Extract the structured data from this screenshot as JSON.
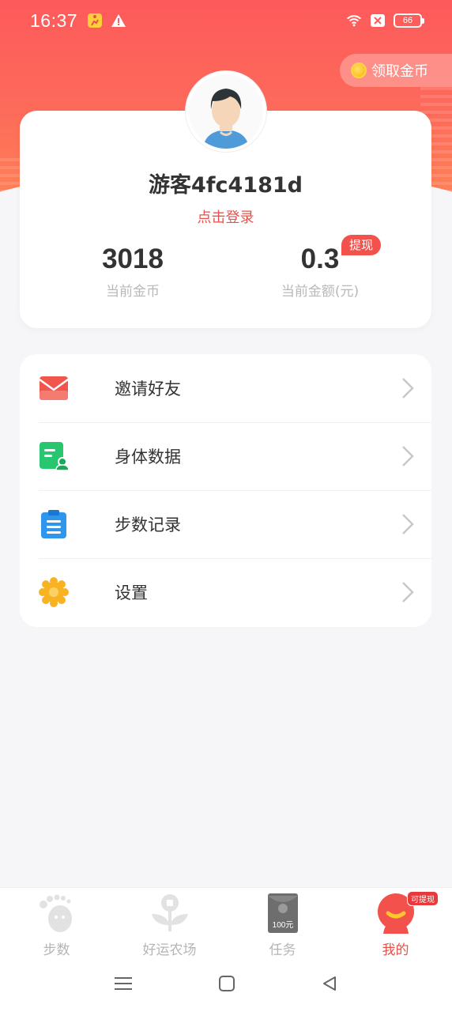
{
  "status_bar": {
    "time": "16:37",
    "battery": "66",
    "left_icons": [
      "run-app-icon",
      "warning-icon"
    ],
    "right_icons": [
      "wifi-icon",
      "sim-off-icon",
      "battery-icon"
    ]
  },
  "coin_pill": {
    "label": "领取金币"
  },
  "profile": {
    "username": "游客4fc4181d",
    "login_text": "点击登录",
    "coins_value": "3018",
    "coins_label": "当前金币",
    "money_value": "0.3",
    "money_label": "当前金额(元)",
    "withdraw_label": "提现"
  },
  "menu": {
    "items": [
      {
        "label": "邀请好友",
        "icon": "envelope-icon"
      },
      {
        "label": "身体数据",
        "icon": "body-data-icon"
      },
      {
        "label": "步数记录",
        "icon": "clipboard-icon"
      },
      {
        "label": "设置",
        "icon": "gear-icon"
      }
    ]
  },
  "bottom_nav": {
    "items": [
      {
        "label": "步数",
        "icon": "footprint-icon",
        "active": false
      },
      {
        "label": "好运农场",
        "icon": "plant-icon",
        "active": false
      },
      {
        "label": "任务",
        "icon": "red-envelope-icon",
        "active": false,
        "image_text": "100元"
      },
      {
        "label": "我的",
        "icon": "profile-icon",
        "active": true,
        "badge": "可提现"
      }
    ]
  },
  "colors": {
    "accent": "#e8514a",
    "header_top": "#fd5a5b",
    "header_bottom": "#ff8a55"
  }
}
